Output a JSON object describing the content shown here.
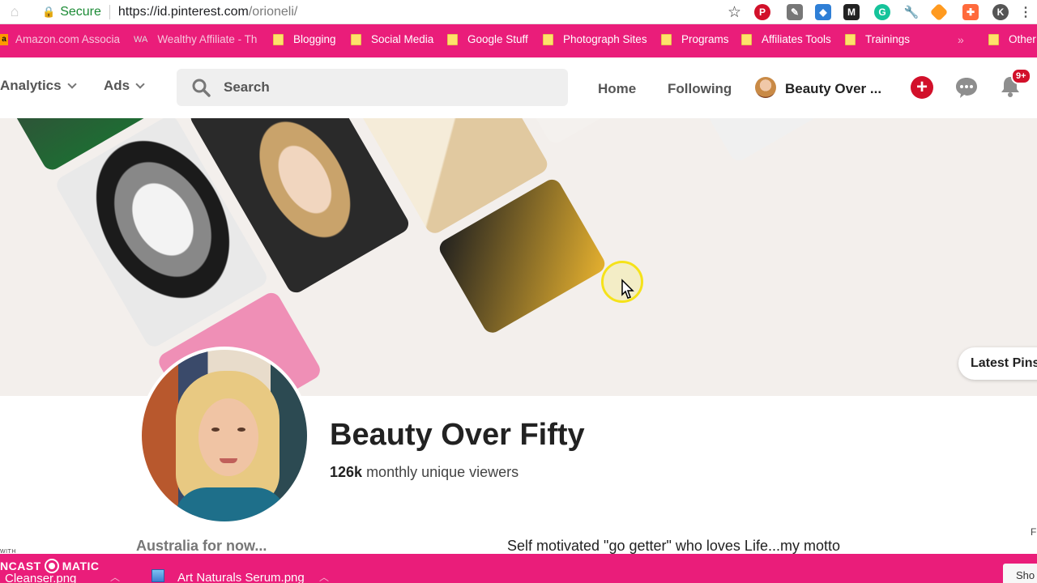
{
  "browser": {
    "secure_label": "Secure",
    "url_host": "https://id.pinterest.com",
    "url_path": "/orioneli/",
    "bookmarks": [
      {
        "label": "Amazon.com Associa",
        "type": "amazon"
      },
      {
        "label": "Wealthy Affiliate - Th",
        "type": "wa"
      },
      {
        "label": "Blogging",
        "type": "folder"
      },
      {
        "label": "Social Media",
        "type": "folder"
      },
      {
        "label": "Google Stuff",
        "type": "folder"
      },
      {
        "label": "Photograph Sites",
        "type": "folder"
      },
      {
        "label": "Programs",
        "type": "folder"
      },
      {
        "label": "Affiliates Tools",
        "type": "folder"
      },
      {
        "label": "Trainings",
        "type": "folder"
      },
      {
        "label": "Other",
        "type": "folder"
      }
    ],
    "more_bookmarks": "»",
    "extension_icons": [
      "pinterest-extension-icon",
      "pen-extension-icon",
      "shield-extension-icon",
      "medium-extension-icon",
      "grammarly-extension-icon",
      "wrench-extension-icon",
      "honey-extension-icon",
      "puzzle-extension-icon",
      "profile-k-icon",
      "menu-dots-icon"
    ],
    "extension_letters": {
      "medium": "M",
      "grammarly": "G",
      "profile": "K"
    }
  },
  "pinterest": {
    "nav": {
      "analytics": "Analytics",
      "ads": "Ads",
      "search_placeholder": "Search",
      "home": "Home",
      "following": "Following",
      "profile_name": "Beauty Over ...",
      "notification_badge": "9+"
    },
    "cover": {
      "latest_pins_button": "Latest Pins"
    },
    "profile": {
      "title": "Beauty Over Fifty",
      "viewers_count": "126k",
      "viewers_label": "monthly unique viewers",
      "location": "Australia for now...",
      "bio": "Self motivated \"go getter\" who loves Life...my motto"
    }
  },
  "colors": {
    "brand_pink": "#ea1d7a",
    "pinterest_red": "#d2102a",
    "secure_green": "#1a8a34"
  },
  "bottom": {
    "castomatic_left": "NCAST",
    "castomatic_right": "MATIC",
    "castomatic_with": "WITH",
    "downloads": [
      "Cleanser.png",
      "Art Naturals Serum.png"
    ],
    "show_all": "Sho"
  }
}
